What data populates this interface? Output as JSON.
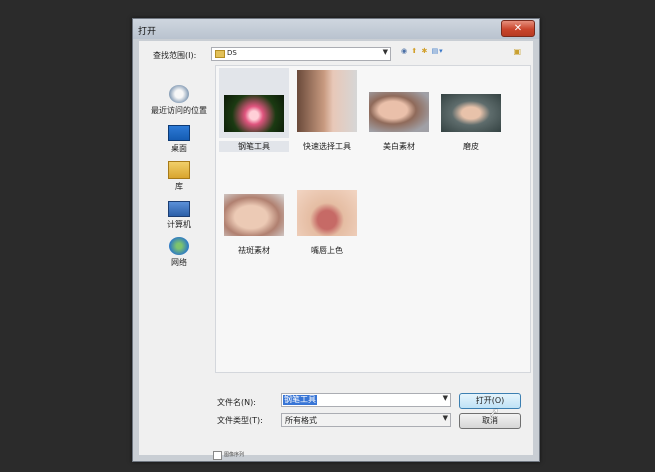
{
  "window": {
    "title": "打开",
    "close_label": "✕"
  },
  "lookin": {
    "label": "查找范围(I):",
    "value": "DS"
  },
  "places": [
    {
      "name": "recent",
      "label": "最近访问的位置"
    },
    {
      "name": "desktop",
      "label": "桌面"
    },
    {
      "name": "library",
      "label": "库"
    },
    {
      "name": "computer",
      "label": "计算机"
    },
    {
      "name": "network",
      "label": "网络"
    }
  ],
  "files": [
    {
      "name": "钢笔工具",
      "selected": true
    },
    {
      "name": "快速选择工具",
      "selected": false
    },
    {
      "name": "美白素材",
      "selected": false
    },
    {
      "name": "磨皮",
      "selected": false
    },
    {
      "name": "祛斑素材",
      "selected": false
    },
    {
      "name": "嘴唇上色",
      "selected": false
    }
  ],
  "filename": {
    "label": "文件名(N):",
    "value": "钢笔工具"
  },
  "filetype": {
    "label": "文件类型(T):",
    "value": "所有格式"
  },
  "buttons": {
    "open": "打开(O)",
    "cancel": "取消"
  },
  "image_sequence": {
    "label": "图像序列",
    "checked": false
  },
  "icons": {
    "places": [
      "recent-places-icon",
      "desktop-icon",
      "library-icon",
      "computer-icon",
      "network-icon"
    ],
    "toolbar": [
      "back-icon",
      "up-folder-icon",
      "new-folder-icon",
      "view-menu-icon"
    ]
  }
}
